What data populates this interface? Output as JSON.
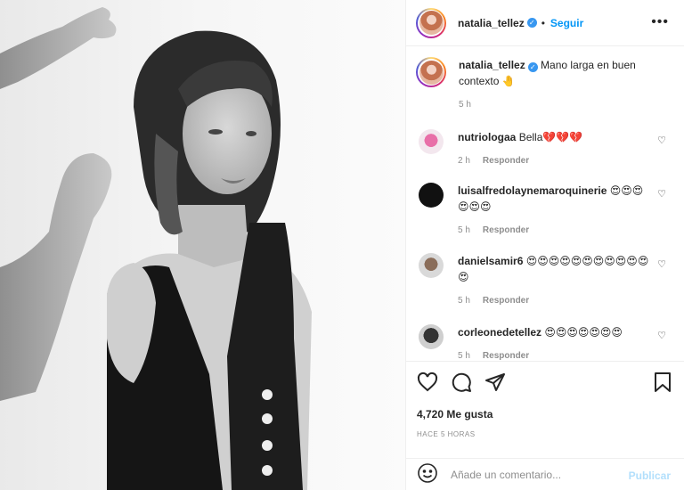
{
  "header": {
    "username": "natalia_tellez",
    "verified_icon": "verified-badge-icon",
    "separator": "•",
    "follow_label": "Seguir",
    "more_label": "•••"
  },
  "caption": {
    "username": "natalia_tellez",
    "text": "Mano larga en buen contexto 🤚",
    "time": "5 h"
  },
  "comments": [
    {
      "username": "nutriologaa",
      "text": "Bella💔💔💔",
      "time": "2 h",
      "reply": "Responder"
    },
    {
      "username": "luisalfredolaynemaroquinerie",
      "text": "😍😍😍😍😍😍",
      "time": "5 h",
      "reply": "Responder"
    },
    {
      "username": "danielsamir6",
      "text": "😍😍😍😍😍😍😍😍😍😍😍😍",
      "time": "5 h",
      "reply": "Responder"
    },
    {
      "username": "corleonedetellez",
      "text": "😍😍😍😍😍😍😍",
      "time": "5 h",
      "reply": "Responder"
    }
  ],
  "actions": {
    "likes": "4,720 Me gusta",
    "posted": "HACE 5 HORAS"
  },
  "composer": {
    "placeholder": "Añade un comentario...",
    "publish_label": "Publicar"
  },
  "icons": {
    "like": "heart-icon",
    "comment": "comment-icon",
    "share": "paper-plane-icon",
    "save": "bookmark-icon",
    "emoji": "smiley-icon"
  },
  "colors": {
    "accent": "#0095f6",
    "publish_disabled": "#b2dffc",
    "muted": "#8e8e8e"
  }
}
